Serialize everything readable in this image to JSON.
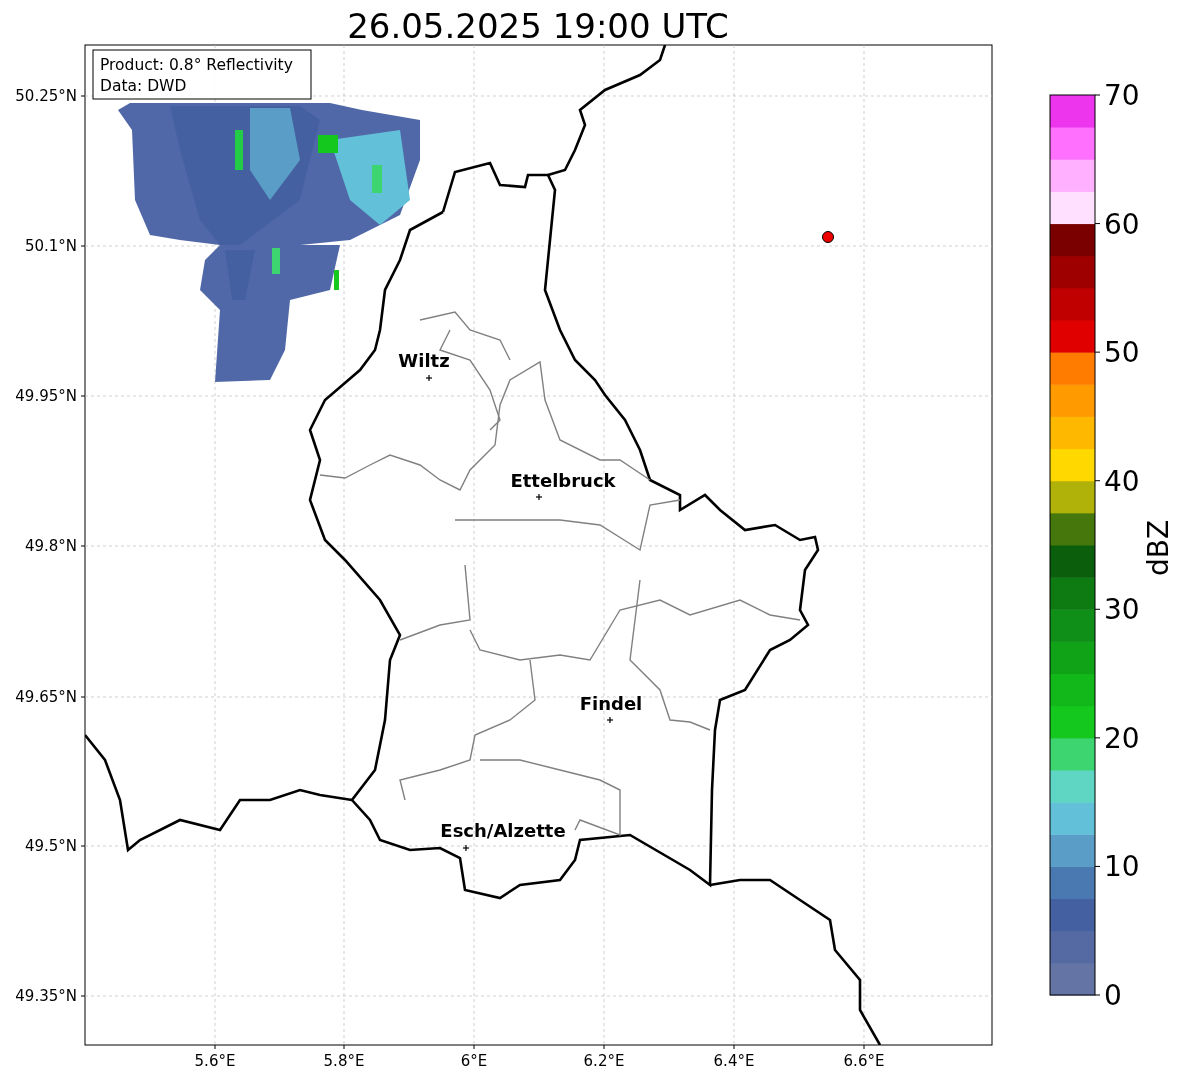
{
  "title": "26.05.2025 19:00 UTC",
  "info_box": {
    "lines": [
      "Product: 0.8° Reflectivity",
      "Data: DWD"
    ]
  },
  "map": {
    "lat_ticks": [
      "50.25°N",
      "50.1°N",
      "49.95°N",
      "49.8°N",
      "49.65°N",
      "49.5°N",
      "49.35°N"
    ],
    "lon_ticks": [
      "5.6°E",
      "5.8°E",
      "6°E",
      "6.2°E",
      "6.4°E",
      "6.6°E"
    ],
    "cities": [
      {
        "name": "Wiltz"
      },
      {
        "name": "Ettelbruck"
      },
      {
        "name": "Findel"
      },
      {
        "name": "Esch/Alzette"
      }
    ]
  },
  "colorbar": {
    "label": "dBZ",
    "ticks": [
      "70",
      "60",
      "50",
      "40",
      "30",
      "20",
      "10",
      "0"
    ],
    "bins": [
      {
        "color": "#6475a5"
      },
      {
        "color": "#556aa3"
      },
      {
        "color": "#4560a0"
      },
      {
        "color": "#4a78b0"
      },
      {
        "color": "#5a9ec8"
      },
      {
        "color": "#62c0d9"
      },
      {
        "color": "#5fd6c4"
      },
      {
        "color": "#3dd56f"
      },
      {
        "color": "#14c81e"
      },
      {
        "color": "#12b81a"
      },
      {
        "color": "#10a318"
      },
      {
        "color": "#0f8f18"
      },
      {
        "color": "#0d7a12"
      },
      {
        "color": "#0a5e0c"
      },
      {
        "color": "#45770d"
      },
      {
        "color": "#b0b20a"
      },
      {
        "color": "#ffd800"
      },
      {
        "color": "#ffb800"
      },
      {
        "color": "#ff9a00"
      },
      {
        "color": "#ff7c00"
      },
      {
        "color": "#e00000"
      },
      {
        "color": "#c00000"
      },
      {
        "color": "#9e0000"
      },
      {
        "color": "#7a0000"
      },
      {
        "color": "#ffe0ff"
      },
      {
        "color": "#ffb0ff"
      },
      {
        "color": "#ff70ff"
      },
      {
        "color": "#ee35ee"
      }
    ]
  }
}
